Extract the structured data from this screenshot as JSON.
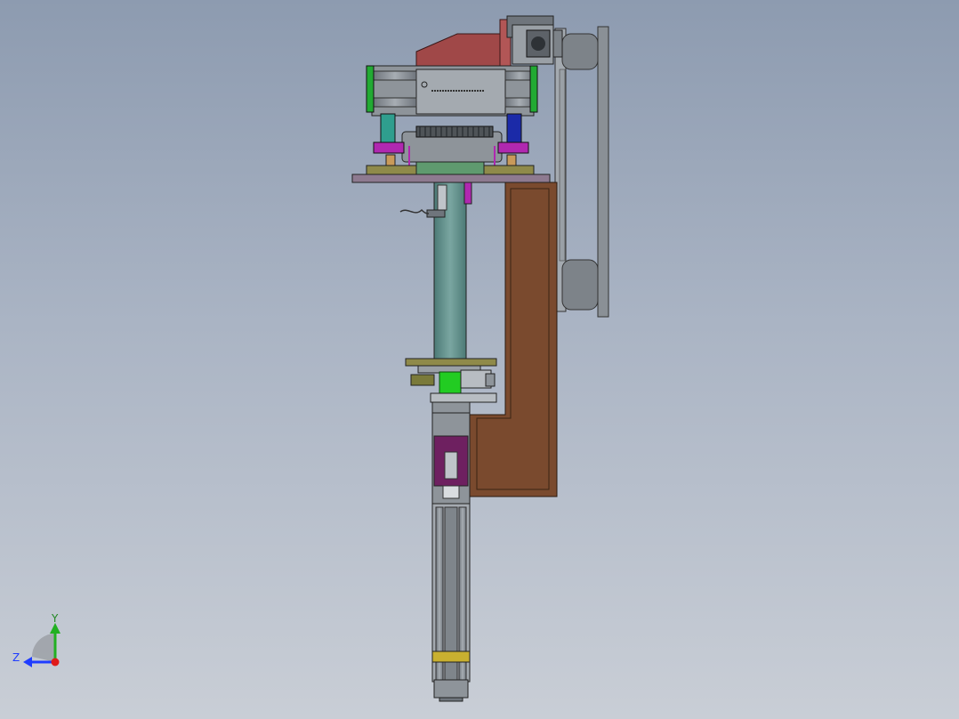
{
  "viewport": {
    "background_top": "#8d9bb0",
    "background_bottom": "#c9ced6"
  },
  "model": {
    "parts_colors": {
      "frame_brown": "#7a4a2e",
      "steel_gray": "#8e949a",
      "top_plate_red": "#a04848",
      "base_plate_purple": "#8e7a90",
      "column_teal": "#5f8e8a",
      "gear_green": "#22cc22",
      "magenta_blocks": "#b028b0",
      "cylinder_green": "#2f9e5a",
      "cylinder_blue": "#1b2aa8",
      "bracket_olive": "#8f8a4a",
      "slide_purple": "#6e2060"
    }
  },
  "triad": {
    "x_axis_label": "Z",
    "y_axis_label": "Y",
    "x_color": "#1f3cff",
    "y_color": "#22b022",
    "origin_color": "#e01a1a"
  }
}
